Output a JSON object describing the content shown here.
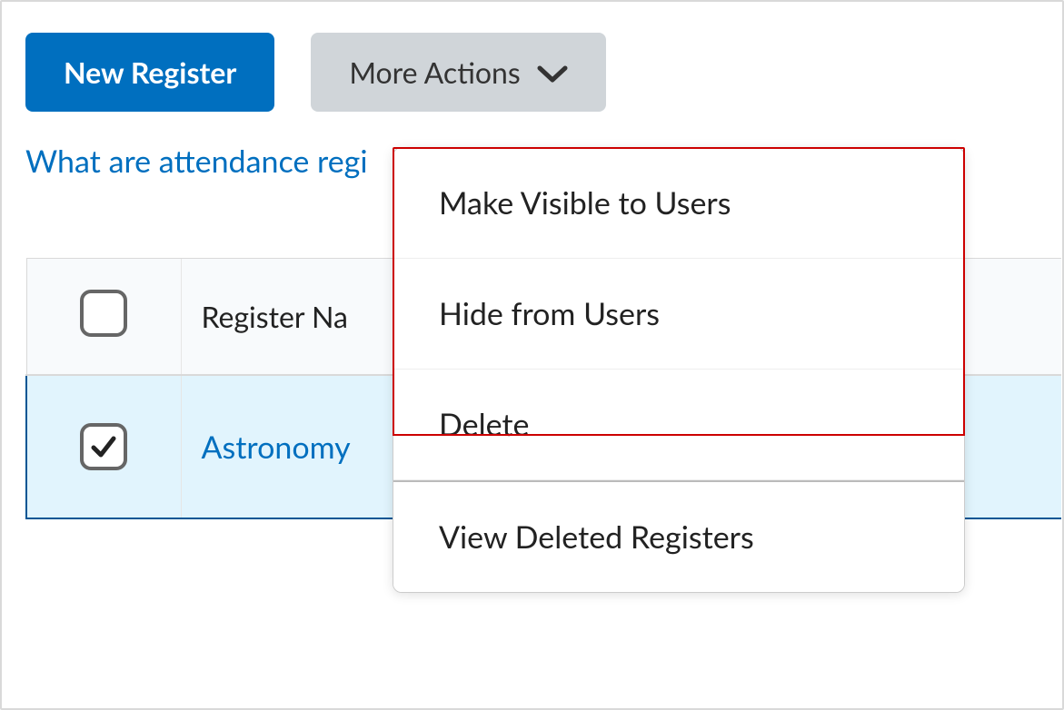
{
  "toolbar": {
    "new_register_label": "New Register",
    "more_actions_label": "More Actions"
  },
  "help_link_text": "What are attendance regi",
  "table": {
    "columns": {
      "name": "Register Na"
    },
    "rows": [
      {
        "name": "Astronomy",
        "checked": true
      }
    ]
  },
  "menu": {
    "make_visible": "Make Visible to Users",
    "hide": "Hide from Users",
    "delete": "Delete",
    "view_deleted": "View Deleted Registers"
  }
}
